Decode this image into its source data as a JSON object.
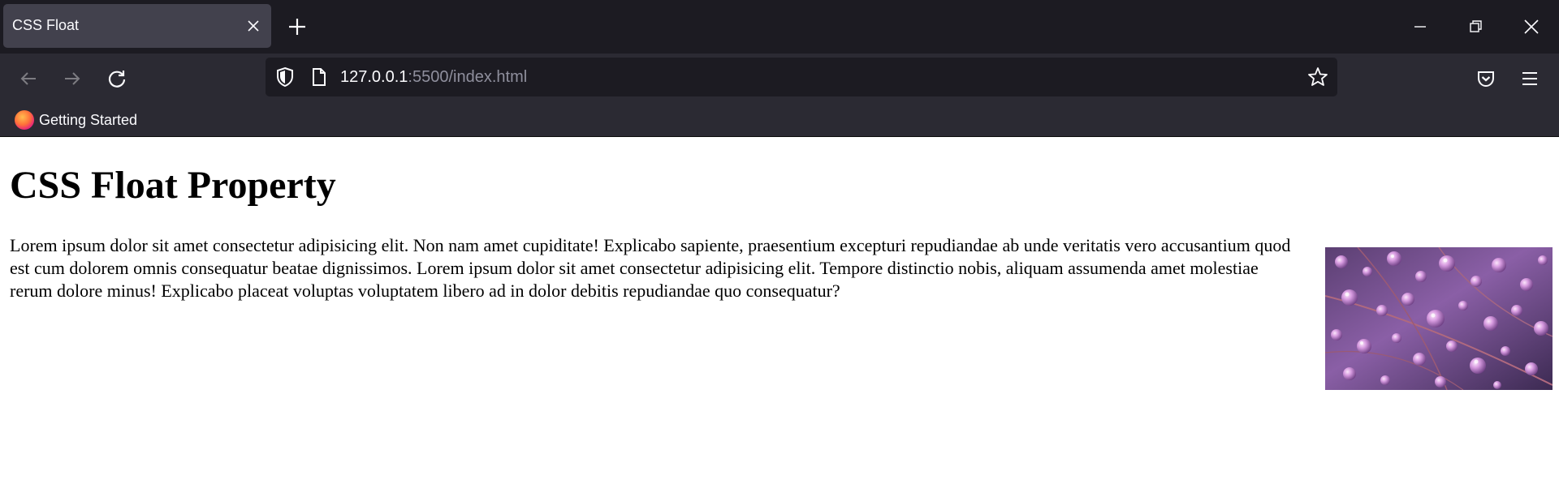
{
  "browser": {
    "tab_title": "CSS Float",
    "url_host": "127.0.0.1",
    "url_rest": ":5500/index.html",
    "bookmark_label": "Getting Started"
  },
  "page": {
    "heading": "CSS Float Property",
    "paragraph": "Lorem ipsum dolor sit amet consectetur adipisicing elit. Non nam amet cupiditate! Explicabo sapiente, praesentium excepturi repudiandae ab unde veritatis vero accusantium quod est cum dolorem omnis consequatur beatae dignissimos. Lorem ipsum dolor sit amet consectetur adipisicing elit. Tempore distinctio nobis, aliquam assumenda amet molestiae rerum dolore minus! Explicabo placeat voluptas voluptatem libero ad in dolor debitis repudiandae quo consequatur?"
  }
}
